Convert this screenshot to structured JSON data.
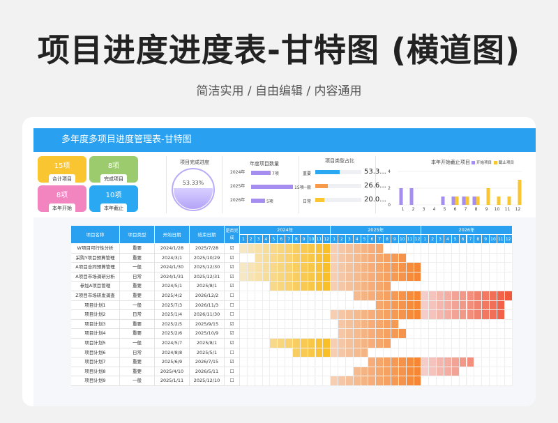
{
  "header": {
    "title": "项目进度进度表-甘特图 (横道图)",
    "subtitle": "简洁实用 / 自由编辑 / 内容通用"
  },
  "sheet": {
    "title": "多年度多项目进度管理表-甘特图"
  },
  "stats": [
    {
      "value": "15项",
      "label": "合计项目",
      "color": "#f9c632"
    },
    {
      "value": "8项",
      "label": "完成项目",
      "color": "#9ccb6e"
    },
    {
      "value": "8项",
      "label": "本年开始",
      "color": "#f285c0"
    },
    {
      "value": "10项",
      "label": "本年截止",
      "color": "#2aa8f2"
    }
  ],
  "completion": {
    "title": "项目完成进度",
    "percent_text": "53.33%",
    "fraction": 0.5333
  },
  "annual": {
    "title": "年度项目数量",
    "color": "#a58ef0",
    "items": [
      {
        "year": "2024年",
        "value": 7,
        "label": "7项"
      },
      {
        "year": "2025年",
        "value": 15,
        "label": "15项"
      },
      {
        "year": "2026年",
        "value": 5,
        "label": "5项"
      }
    ]
  },
  "types": {
    "title": "项目类型占比",
    "items": [
      {
        "name": "重要",
        "fraction": 0.533,
        "label": "53.3...",
        "color": "#2aa8f2"
      },
      {
        "name": "一般",
        "fraction": 0.267,
        "label": "26.6...",
        "color": "#f79a4a"
      },
      {
        "name": "日常",
        "fraction": 0.2,
        "label": "20.0...",
        "color": "#f9c632"
      }
    ]
  },
  "chart_data": {
    "type": "bar",
    "title": "本年开始截止项目",
    "legend": [
      "开始项目",
      "截止项目"
    ],
    "colors": [
      "#a58ef0",
      "#f9c632"
    ],
    "categories": [
      "1",
      "2",
      "3",
      "4",
      "5",
      "6",
      "7",
      "8",
      "9",
      "10",
      "11",
      "12"
    ],
    "series": [
      {
        "name": "开始项目",
        "values": [
          2,
          2,
          0,
          0,
          1,
          1,
          1,
          1,
          0,
          0,
          0,
          0
        ]
      },
      {
        "name": "截止项目",
        "values": [
          0,
          0,
          0,
          0,
          0,
          1,
          1,
          1,
          2,
          1,
          1,
          3
        ]
      }
    ],
    "yticks": [
      "4",
      "2",
      "0"
    ],
    "ylim": [
      0,
      4
    ]
  },
  "table": {
    "headers": [
      "项目名称",
      "项目类型",
      "开始日期",
      "结束日期",
      "是否完成"
    ],
    "years": [
      "2024年",
      "2025年",
      "2026年"
    ],
    "months": [
      "1",
      "2",
      "3",
      "4",
      "5",
      "6",
      "7",
      "8",
      "9",
      "10",
      "11",
      "12"
    ],
    "rows": [
      {
        "name": "W项目可行性分析",
        "type": "重要",
        "start": "2024/1/28",
        "end": "2025/7/28",
        "done": "☑",
        "s": 1,
        "e": 19
      },
      {
        "name": "采购Y项目预算管理",
        "type": "重要",
        "start": "2024/3/1",
        "end": "2025/10/29",
        "done": "☑",
        "s": 3,
        "e": 22
      },
      {
        "name": "A项目合同预算管理",
        "type": "一般",
        "start": "2024/1/30",
        "end": "2025/12/30",
        "done": "☑",
        "s": 1,
        "e": 24
      },
      {
        "name": "A项目市场调研分析",
        "type": "日常",
        "start": "2024/1/31",
        "end": "2025/12/31",
        "done": "☑",
        "s": 1,
        "e": 24
      },
      {
        "name": "参加A项目管理",
        "type": "重要",
        "start": "2024/5/1",
        "end": "2025/8/1",
        "done": "☑",
        "s": 5,
        "e": 20
      },
      {
        "name": "Z项目市场研发调查",
        "type": "重要",
        "start": "2025/4/2",
        "end": "2026/12/2",
        "done": "☐",
        "s": 16,
        "e": 36
      },
      {
        "name": "项目计划1",
        "type": "一般",
        "start": "2025/7/3",
        "end": "2026/11/3",
        "done": "☐",
        "s": 19,
        "e": 35
      },
      {
        "name": "项目计划2",
        "type": "日常",
        "start": "2025/1/4",
        "end": "2026/11/30",
        "done": "☐",
        "s": 13,
        "e": 35
      },
      {
        "name": "项目计划3",
        "type": "重要",
        "start": "2025/2/5",
        "end": "2025/9/15",
        "done": "☑",
        "s": 14,
        "e": 21
      },
      {
        "name": "项目计划4",
        "type": "重要",
        "start": "2025/2/6",
        "end": "2025/10/9",
        "done": "☑",
        "s": 14,
        "e": 22
      },
      {
        "name": "项目计划5",
        "type": "一般",
        "start": "2024/5/7",
        "end": "2025/8/1",
        "done": "☑",
        "s": 5,
        "e": 20
      },
      {
        "name": "项目计划6",
        "type": "日常",
        "start": "2024/8/8",
        "end": "2025/5/1",
        "done": "☐",
        "s": 8,
        "e": 17
      },
      {
        "name": "项目计划7",
        "type": "重要",
        "start": "2025/6/9",
        "end": "2026/7/15",
        "done": "☑",
        "s": 18,
        "e": 31
      },
      {
        "name": "项目计划8",
        "type": "重要",
        "start": "2025/4/10",
        "end": "2026/5/11",
        "done": "☐",
        "s": 16,
        "e": 29
      },
      {
        "name": "项目计划9",
        "type": "一般",
        "start": "2025/1/11",
        "end": "2025/12/10",
        "done": "☐",
        "s": 13,
        "e": 24
      }
    ]
  }
}
